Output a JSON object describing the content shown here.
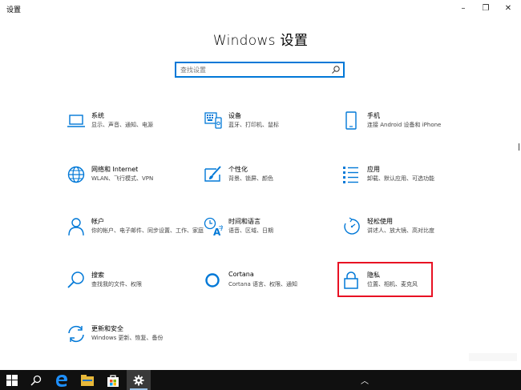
{
  "window": {
    "title": "设置",
    "min_icon": "–",
    "max_icon": "❐",
    "close_icon": "✕"
  },
  "heading": "Windows 设置",
  "search": {
    "placeholder": "查找设置",
    "value": ""
  },
  "tiles": [
    {
      "name": "系统",
      "desc": "显示、声音、通知、电源",
      "icon": "laptop-icon"
    },
    {
      "name": "设备",
      "desc": "蓝牙、打印机、鼠标",
      "icon": "keyboard-icon"
    },
    {
      "name": "手机",
      "desc": "连接 Android 设备和 iPhone",
      "icon": "phone-icon"
    },
    {
      "name": "网络和 Internet",
      "desc": "WLAN、飞行模式、VPN",
      "icon": "globe-icon"
    },
    {
      "name": "个性化",
      "desc": "背景、锁屏、颜色",
      "icon": "paintbrush-icon"
    },
    {
      "name": "应用",
      "desc": "卸载、默认应用、可选功能",
      "icon": "apps-list-icon"
    },
    {
      "name": "帐户",
      "desc": "你的帐户、电子邮件、同步设置、工作、家庭",
      "icon": "person-icon"
    },
    {
      "name": "时间和语言",
      "desc": "语音、区域、日期",
      "icon": "time-language-icon"
    },
    {
      "name": "轻松使用",
      "desc": "讲述人、放大镜、高对比度",
      "icon": "ease-of-access-icon"
    },
    {
      "name": "搜索",
      "desc": "查找我的文件、权限",
      "icon": "search-icon"
    },
    {
      "name": "Cortana",
      "desc": "Cortana 语言、权限、通知",
      "icon": "cortana-ring-icon"
    },
    {
      "name": "隐私",
      "desc": "位置、相机、麦克风",
      "icon": "lock-icon"
    },
    {
      "name": "更新和安全",
      "desc": "Windows 更新、恢复、备份",
      "icon": "update-sync-icon"
    }
  ],
  "taskbar": {
    "items": [
      "windows-start-icon",
      "search-icon",
      "edge-icon",
      "file-explorer-icon",
      "store-icon",
      "settings-gear-icon"
    ],
    "tray_icon": "chevron-up-icon",
    "tray_glyph": "︿"
  },
  "colors": {
    "accent": "#0078d7",
    "highlight": "#e81123",
    "taskbar": "#101010"
  }
}
